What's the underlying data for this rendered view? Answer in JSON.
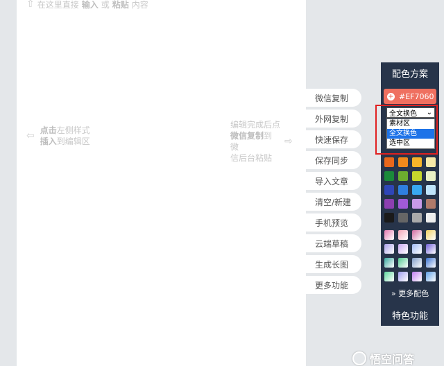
{
  "editor": {
    "top_hint": {
      "prefix": "在这里直接",
      "bold1": "输入",
      "mid": "或",
      "bold2": "粘贴",
      "suffix": "内容"
    },
    "left_hint": {
      "line1_bold": "点击",
      "line1_rest": "左侧样式",
      "line2_bold": "插入",
      "line2_rest": "到编辑区"
    },
    "right_hint": {
      "line1": "编辑完成后点",
      "line2_bold": "微信复制",
      "line2_rest": "到微",
      "line3": "信后台粘贴"
    }
  },
  "actions": [
    {
      "label": "微信复制"
    },
    {
      "label": "外网复制"
    },
    {
      "label": "快速保存"
    },
    {
      "label": "保存同步"
    },
    {
      "label": "导入文章"
    },
    {
      "label": "清空/新建"
    },
    {
      "label": "手机预览"
    },
    {
      "label": "云端草稿"
    },
    {
      "label": "生成长图"
    },
    {
      "label": "更多功能"
    }
  ],
  "color_panel": {
    "title": "配色方案",
    "current_color": "#EF7060",
    "scope_select": {
      "value": "全文换色",
      "options": [
        "素材区",
        "全文换色",
        "选中区"
      ],
      "selected_index": 1
    },
    "solid_swatches": [
      [
        "#e8671c",
        "#f08a1c",
        "#f5b42a",
        "#f6e9a8"
      ],
      [
        "#1a8a3a",
        "#6cae2e",
        "#c6d82c",
        "#e8f0c4"
      ],
      [
        "#2f46b8",
        "#2f7fe0",
        "#38a8f0",
        "#bfe4fa"
      ],
      [
        "#8c3fb0",
        "#a05ad8",
        "#c89ae8",
        "#b07a6a"
      ],
      [
        "#1a1a1a",
        "#666666",
        "#aaaaaa",
        "#eeeeee"
      ]
    ],
    "gradient_swatches": [
      [
        "#e57ab0",
        "#f4a6b8",
        "#d06aa0",
        "#f0d060"
      ],
      [
        "#a8a0e8",
        "#c8a8f0",
        "#9fb8f4",
        "#7060d8"
      ],
      [
        "#3aa8a0",
        "#50c890",
        "#809cc8",
        "#3a70d0"
      ],
      [
        "#60d8a0",
        "#a0a0f0",
        "#c080f0",
        "#60a0e8"
      ]
    ],
    "more_label": "更多配色",
    "feature_label": "特色功能"
  },
  "watermark": "悟空问答"
}
